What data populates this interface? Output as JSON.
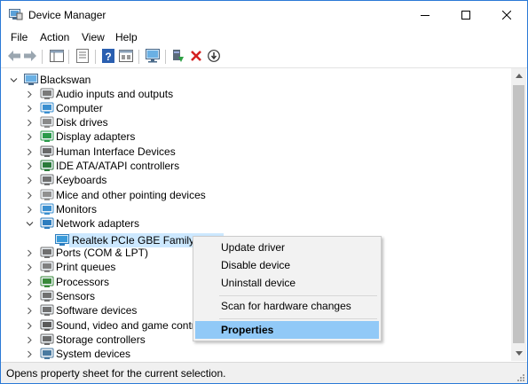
{
  "window": {
    "title": "Device Manager",
    "minimize_icon": "minimize-icon",
    "maximize_icon": "maximize-icon",
    "close_icon": "close-icon"
  },
  "menu": [
    "File",
    "Action",
    "View",
    "Help"
  ],
  "toolbar_icons": [
    "back-arrow-icon",
    "forward-arrow-icon",
    "show-hide-console-tree-icon",
    "properties-icon",
    "help-icon",
    "view-icon",
    "monitor-scan-icon",
    "update-driver-icon",
    "uninstall-icon",
    "disable-device-icon"
  ],
  "tree": {
    "root": "Blackswan",
    "categories": [
      {
        "label": "Audio inputs and outputs",
        "icon": "speaker-icon"
      },
      {
        "label": "Computer",
        "icon": "computer-icon"
      },
      {
        "label": "Disk drives",
        "icon": "disk-drive-icon"
      },
      {
        "label": "Display adapters",
        "icon": "display-adapter-icon"
      },
      {
        "label": "Human Interface Devices",
        "icon": "hid-icon"
      },
      {
        "label": "IDE ATA/ATAPI controllers",
        "icon": "ide-controller-icon"
      },
      {
        "label": "Keyboards",
        "icon": "keyboard-icon"
      },
      {
        "label": "Mice and other pointing devices",
        "icon": "mouse-icon"
      },
      {
        "label": "Monitors",
        "icon": "monitor-icon"
      },
      {
        "label": "Network adapters",
        "icon": "network-adapter-icon",
        "expanded": true
      },
      {
        "label": "Ports (COM & LPT)",
        "icon": "port-icon"
      },
      {
        "label": "Print queues",
        "icon": "printer-icon"
      },
      {
        "label": "Processors",
        "icon": "processor-icon"
      },
      {
        "label": "Sensors",
        "icon": "sensor-icon"
      },
      {
        "label": "Software devices",
        "icon": "software-device-icon"
      },
      {
        "label": "Sound, video and game controll",
        "icon": "sound-icon"
      },
      {
        "label": "Storage controllers",
        "icon": "storage-controller-icon"
      },
      {
        "label": "System devices",
        "icon": "system-device-icon"
      }
    ],
    "selected_device": "Realtek PCIe GBE Family Contr"
  },
  "context_menu": {
    "items": [
      "Update driver",
      "Disable device",
      "Uninstall device"
    ],
    "scan": "Scan for hardware changes",
    "properties": "Properties"
  },
  "status": {
    "text": "Opens property sheet for the current selection."
  }
}
